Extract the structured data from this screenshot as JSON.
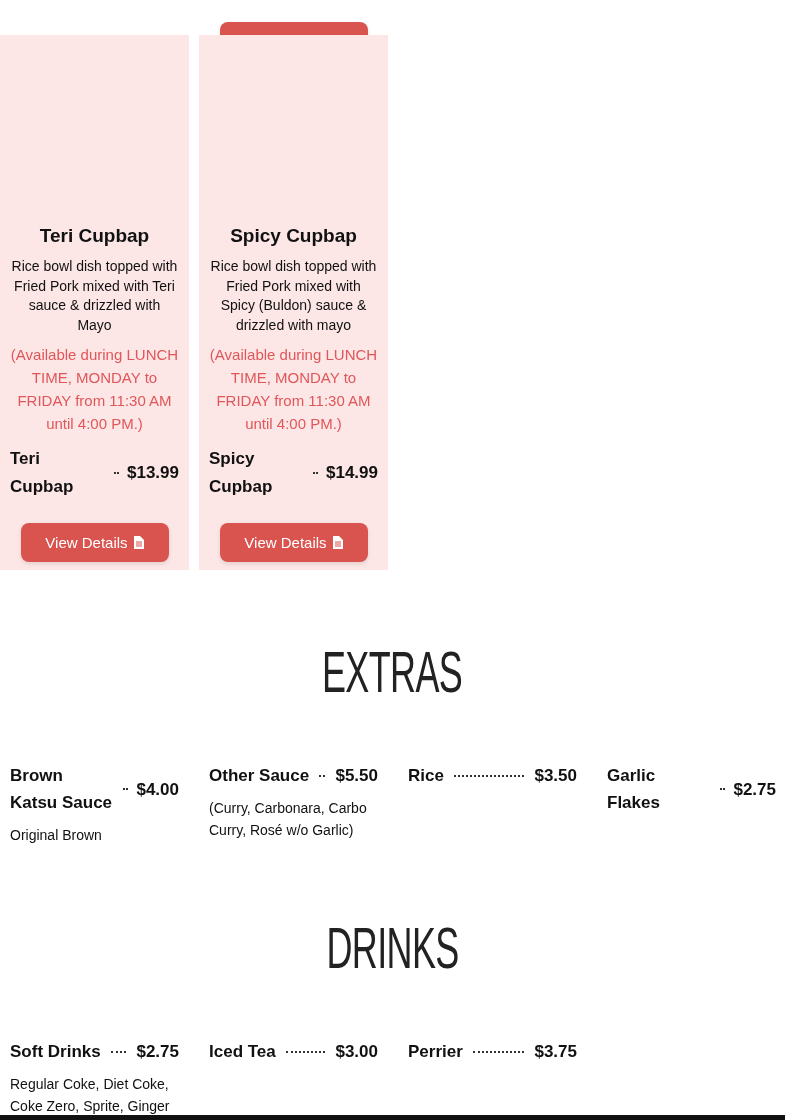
{
  "cut_off_button": {
    "kind": "button"
  },
  "cards": [
    {
      "name": "Teri Cupbap",
      "description": "Rice bowl dish topped with Fried Pork mixed with Teri sauce & drizzled with Mayo",
      "availability": "(Available during LUNCH TIME, MONDAY to FRIDAY from 11:30 AM until 4:00 PM.)",
      "price_name": "Teri Cupbap",
      "price": "$13.99",
      "button_label": "View Details"
    },
    {
      "name": "Spicy Cupbap",
      "description": "Rice bowl dish topped with Fried Pork mixed with Spicy (Buldon) sauce & drizzled with mayo",
      "availability": "(Available during LUNCH TIME, MONDAY to FRIDAY from 11:30 AM until 4:00 PM.)",
      "price_name": "Spicy Cupbap",
      "price": "$14.99",
      "button_label": "View Details"
    }
  ],
  "sections": [
    {
      "title": "EXTRAS",
      "items": [
        {
          "name": "Brown Katsu Sauce",
          "price": "$4.00",
          "description": "Original Brown"
        },
        {
          "name": "Other Sauce",
          "price": "$5.50",
          "description": "(Curry, Carbonara, Carbo Curry, Rosé w/o Garlic)"
        },
        {
          "name": "Rice",
          "price": "$3.50"
        },
        {
          "name": "Garlic Flakes",
          "price": "$2.75"
        }
      ]
    },
    {
      "title": "DRINKS",
      "items": [
        {
          "name": "Soft Drinks",
          "price": "$2.75",
          "description": "Regular Coke, Diet Coke, Coke Zero, Sprite, Ginger"
        },
        {
          "name": "Iced Tea",
          "price": "$3.00"
        },
        {
          "name": "Perrier",
          "price": "$3.75"
        }
      ]
    }
  ]
}
